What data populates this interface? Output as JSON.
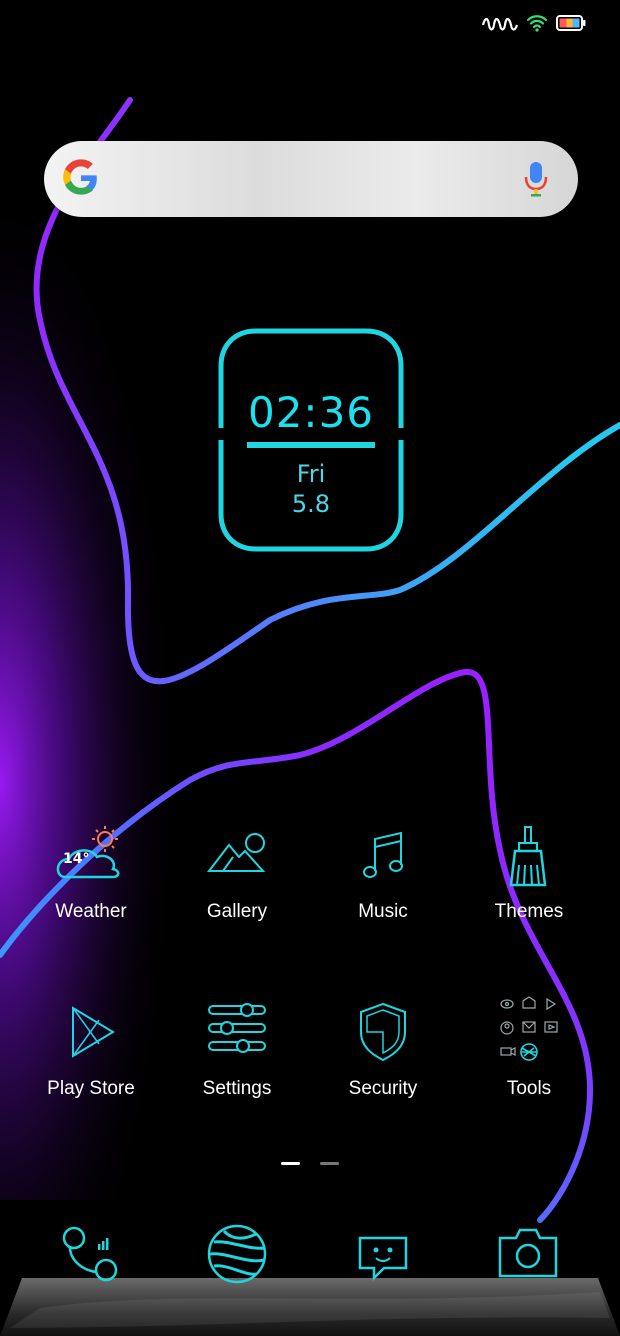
{
  "status_bar": {
    "icons": [
      "signal-wave-icon",
      "wifi-icon",
      "battery-icon"
    ]
  },
  "search": {
    "logo": "google-logo",
    "mic_icon": "mic-icon"
  },
  "clock": {
    "time": "02:36",
    "day": "Fri",
    "date": "5.8"
  },
  "apps": {
    "row1": [
      {
        "label": "Weather",
        "icon": "weather-icon",
        "temp": "14°"
      },
      {
        "label": "Gallery",
        "icon": "gallery-icon"
      },
      {
        "label": "Music",
        "icon": "music-icon"
      },
      {
        "label": "Themes",
        "icon": "themes-icon"
      }
    ],
    "row2": [
      {
        "label": "Play Store",
        "icon": "play-store-icon"
      },
      {
        "label": "Settings",
        "icon": "settings-icon"
      },
      {
        "label": "Security",
        "icon": "security-icon"
      },
      {
        "label": "Tools",
        "icon": "tools-folder-icon"
      }
    ]
  },
  "page_indicator": {
    "pages": 2,
    "current": 1
  },
  "dock": [
    {
      "icon": "phone-icon"
    },
    {
      "icon": "browser-globe-icon"
    },
    {
      "icon": "messages-icon"
    },
    {
      "icon": "camera-icon"
    }
  ],
  "colors": {
    "accent": "#18e2f0",
    "purple": "#9b1fff",
    "background": "#000000"
  }
}
